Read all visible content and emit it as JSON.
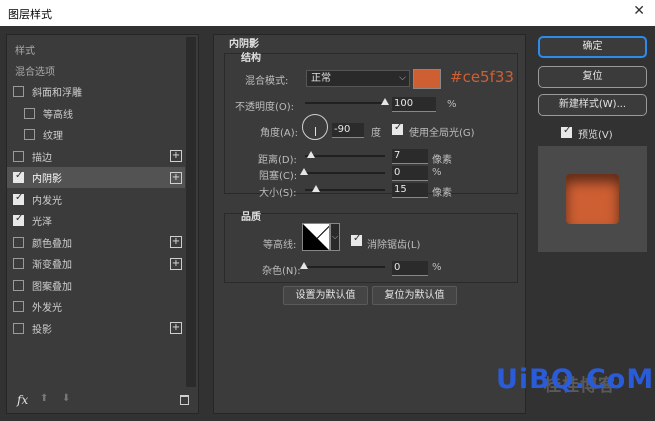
{
  "window": {
    "title": "图层样式",
    "close_glyph": "✕"
  },
  "left_panel": {
    "header": "样式",
    "blend_options": "混合选项",
    "items": [
      {
        "label": "斜面和浮雕",
        "checked": false,
        "plus": false,
        "indent": false
      },
      {
        "label": "等高线",
        "checked": false,
        "plus": false,
        "indent": true
      },
      {
        "label": "纹理",
        "checked": false,
        "plus": false,
        "indent": true
      },
      {
        "label": "描边",
        "checked": false,
        "plus": true,
        "indent": false
      },
      {
        "label": "内阴影",
        "checked": true,
        "plus": true,
        "indent": false,
        "selected": true
      },
      {
        "label": "内发光",
        "checked": true,
        "plus": false,
        "indent": false
      },
      {
        "label": "光泽",
        "checked": true,
        "plus": false,
        "indent": false
      },
      {
        "label": "颜色叠加",
        "checked": false,
        "plus": true,
        "indent": false
      },
      {
        "label": "渐变叠加",
        "checked": false,
        "plus": true,
        "indent": false
      },
      {
        "label": "图案叠加",
        "checked": false,
        "plus": false,
        "indent": false
      },
      {
        "label": "外发光",
        "checked": false,
        "plus": false,
        "indent": false
      },
      {
        "label": "投影",
        "checked": false,
        "plus": true,
        "indent": false
      }
    ],
    "footer": {
      "fx": "fx",
      "up": "⬆",
      "down": "⬇",
      "trash": "🗑"
    }
  },
  "inner_shadow": {
    "section_title": "内阴影",
    "structure_title": "结构",
    "blend_mode_label": "混合模式:",
    "blend_mode_value": "正常",
    "color_hex": "#ce5f33",
    "color_label": "#ce5f33",
    "opacity_label": "不透明度(O):",
    "opacity_value": "100",
    "opacity_unit": "%",
    "opacity_fraction": 1.0,
    "angle_label": "角度(A):",
    "angle_value": "-90",
    "angle_unit": "度",
    "global_light_label": "使用全局光(G)",
    "global_light_checked": true,
    "distance_label": "距离(D):",
    "distance_value": "7",
    "distance_unit": "像素",
    "distance_fraction": 0.03,
    "choke_label": "阻塞(C):",
    "choke_value": "0",
    "choke_unit": "%",
    "choke_fraction": 0.0,
    "size_label": "大小(S):",
    "size_value": "15",
    "size_unit": "像素",
    "size_fraction": 0.06,
    "quality_title": "品质",
    "contour_label": "等高线:",
    "antialias_label": "消除锯齿(L)",
    "antialias_checked": true,
    "noise_label": "杂色(N):",
    "noise_value": "0",
    "noise_unit": "%",
    "noise_fraction": 0.0,
    "set_default": "设置为默认值",
    "reset_default": "复位为默认值"
  },
  "right_panel": {
    "ok": "确定",
    "reset": "复位",
    "new_style": "新建样式(W)...",
    "preview_label": "预览(V)",
    "preview_checked": true,
    "preview_color": "#ce5f33"
  },
  "watermark": {
    "text": "UiBQ.CoM",
    "cn_text": "桂桂博客"
  }
}
